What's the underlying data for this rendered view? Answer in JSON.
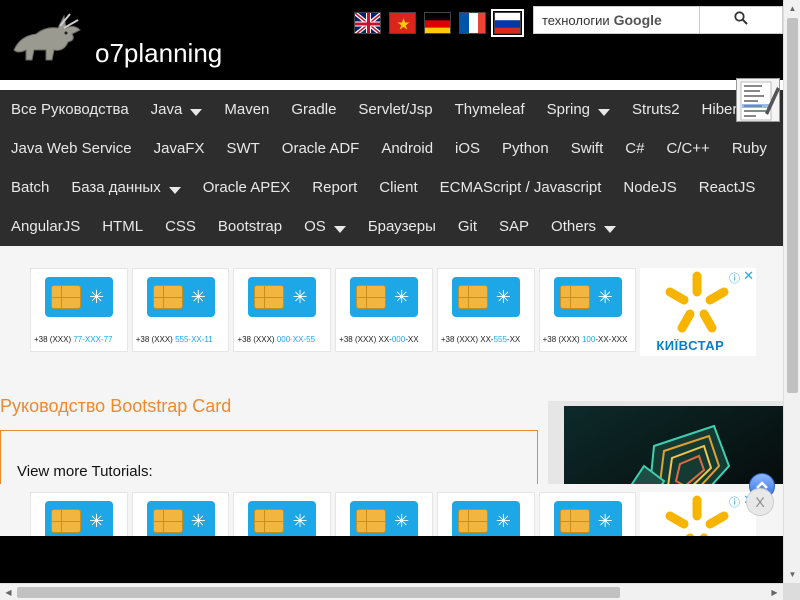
{
  "header": {
    "site_name": "o7planning",
    "flags": [
      {
        "icon": "flag-uk-icon",
        "selected": false
      },
      {
        "icon": "flag-vietnam-icon",
        "selected": false
      },
      {
        "icon": "flag-germany-icon",
        "selected": false
      },
      {
        "icon": "flag-france-icon",
        "selected": false
      },
      {
        "icon": "flag-russia-icon",
        "selected": true
      }
    ],
    "search": {
      "value": "технологии",
      "brand": "Google",
      "button_icon": "search-icon"
    }
  },
  "nav": {
    "rows": [
      [
        "Все Руководства",
        "Java",
        "Maven",
        "Gradle",
        "Servlet/Jsp",
        "Thymeleaf",
        "Spring",
        "Struts2",
        "Hibernate"
      ],
      [
        "Java Web Service",
        "JavaFX",
        "SWT",
        "Oracle ADF",
        "Android",
        "iOS",
        "Python",
        "Swift",
        "C#",
        "C/C++",
        "Ruby"
      ],
      [
        "Batch",
        "База данных",
        "Oracle APEX",
        "Report",
        "Client",
        "ECMAScript / Javascript",
        "NodeJS",
        "ReactJS"
      ],
      [
        "AngularJS",
        "HTML",
        "CSS",
        "Bootstrap",
        "OS",
        "Браузеры",
        "Git",
        "SAP",
        "Others"
      ]
    ],
    "dropdowns": [
      "Java",
      "Spring",
      "База данных",
      "OS",
      "Others"
    ]
  },
  "ad": {
    "cards": [
      {
        "prefix": "+38 (XXX) ",
        "highlight": "77-XXX-77",
        "suffix": ""
      },
      {
        "prefix": "+38 (XXX) ",
        "highlight": "555-XX-11",
        "suffix": ""
      },
      {
        "prefix": "+38 (XXX) ",
        "highlight": "000-XX-55",
        "suffix": ""
      },
      {
        "prefix": "+38 (XXX) XX-",
        "highlight": "000",
        "suffix": "-XX"
      },
      {
        "prefix": "+38 (XXX) XX-",
        "highlight": "555",
        "suffix": "-XX"
      },
      {
        "prefix": "+38 (XXX) ",
        "highlight": "100",
        "suffix": "-XX-XXX"
      }
    ],
    "brand": "КИЇВСТАР",
    "info_icon": "ⓘ",
    "close_icon": "✕",
    "accent_color": "#1ea7e6"
  },
  "main": {
    "title": "Руководство Bootstrap Card",
    "view_more": "View more Tutorials:",
    "title_color": "#f0892d"
  },
  "bottom_ad": {
    "close_label": "X"
  }
}
